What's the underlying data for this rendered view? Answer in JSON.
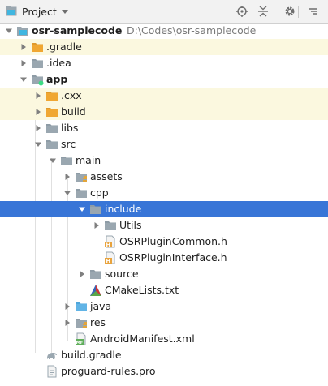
{
  "header": {
    "title": "Project",
    "icons": [
      "project-icon",
      "dropdown-icon",
      "locate-icon",
      "collapse-all-icon",
      "settings-icon",
      "hide-icon"
    ]
  },
  "tree": [
    {
      "label": "osr-samplecode",
      "path": "D:\\Codes\\osr-samplecode",
      "bold": true,
      "expanded": true,
      "icon": "module-folder-icon"
    },
    {
      "label": ".gradle",
      "expanded": false,
      "icon": "orange-folder-icon",
      "highlight": "yellow"
    },
    {
      "label": ".idea",
      "expanded": false,
      "icon": "gray-folder-icon"
    },
    {
      "label": "app",
      "bold": true,
      "expanded": true,
      "icon": "android-module-icon"
    },
    {
      "label": ".cxx",
      "expanded": false,
      "icon": "orange-folder-icon",
      "highlight": "yellow"
    },
    {
      "label": "build",
      "expanded": false,
      "icon": "orange-folder-icon",
      "highlight": "yellow"
    },
    {
      "label": "libs",
      "expanded": false,
      "icon": "gray-folder-icon"
    },
    {
      "label": "src",
      "expanded": true,
      "icon": "gray-folder-icon"
    },
    {
      "label": "main",
      "expanded": true,
      "icon": "gray-folder-icon"
    },
    {
      "label": "assets",
      "expanded": false,
      "icon": "resource-folder-icon"
    },
    {
      "label": "cpp",
      "expanded": true,
      "icon": "gray-folder-icon"
    },
    {
      "label": "include",
      "expanded": true,
      "icon": "gray-folder-icon",
      "selected": true
    },
    {
      "label": "Utils",
      "expanded": false,
      "icon": "gray-folder-icon"
    },
    {
      "label": "OSRPluginCommon.h",
      "icon": "h-file-icon"
    },
    {
      "label": "OSRPluginInterface.h",
      "icon": "h-file-icon"
    },
    {
      "label": "source",
      "expanded": false,
      "icon": "gray-folder-icon"
    },
    {
      "label": "CMakeLists.txt",
      "icon": "cmake-icon"
    },
    {
      "label": "java",
      "expanded": false,
      "icon": "blue-folder-icon"
    },
    {
      "label": "res",
      "expanded": false,
      "icon": "resource-folder-icon"
    },
    {
      "label": "AndroidManifest.xml",
      "icon": "manifest-icon"
    },
    {
      "label": "build.gradle",
      "icon": "gradle-icon"
    },
    {
      "label": "proguard-rules.pro",
      "icon": "file-icon"
    }
  ],
  "colors": {
    "selection": "#3875d7",
    "highlight": "#fbf8df",
    "folder_gray": "#9aa7b0",
    "folder_orange": "#f0a732",
    "folder_blue": "#61b4e6"
  }
}
